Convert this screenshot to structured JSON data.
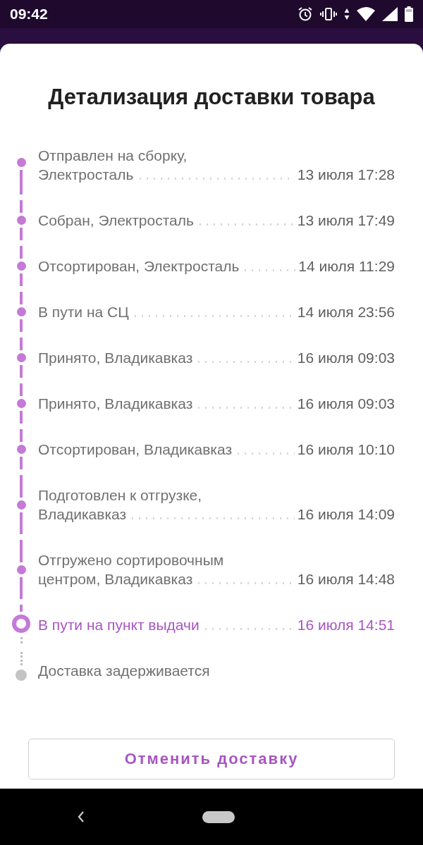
{
  "status_bar": {
    "time": "09:42"
  },
  "sheet": {
    "title": "Детализация доставки товара",
    "events": [
      {
        "kind": "done",
        "lines": [
          "Отправлен на сборку,",
          "Электросталь"
        ],
        "date": "13 июля 17:28"
      },
      {
        "kind": "done",
        "lines": [
          "Собран, Электросталь"
        ],
        "date": "13 июля 17:49"
      },
      {
        "kind": "done",
        "lines": [
          "Отсортирован, Электросталь"
        ],
        "date": "14 июля 11:29"
      },
      {
        "kind": "done",
        "lines": [
          "В пути на СЦ"
        ],
        "date": "14 июля 23:56"
      },
      {
        "kind": "done",
        "lines": [
          "Принято, Владикавказ"
        ],
        "date": "16 июля 09:03"
      },
      {
        "kind": "done",
        "lines": [
          "Принято, Владикавказ"
        ],
        "date": "16 июля 09:03"
      },
      {
        "kind": "done",
        "lines": [
          "Отсортирован, Владикавказ"
        ],
        "date": "16 июля 10:10"
      },
      {
        "kind": "done",
        "lines": [
          "Подготовлен к отгрузке,",
          "Владикавказ"
        ],
        "date": "16 июля 14:09"
      },
      {
        "kind": "done",
        "lines": [
          "Отгружено сортировочным",
          "центром, Владикавказ"
        ],
        "date": "16 июля 14:48"
      },
      {
        "kind": "current",
        "lines": [
          "В пути на пункт выдачи"
        ],
        "date": "16 июля 14:51"
      },
      {
        "kind": "pending",
        "lines": [
          "Доставка задерживается"
        ]
      }
    ],
    "button": "Отменить доставку"
  }
}
